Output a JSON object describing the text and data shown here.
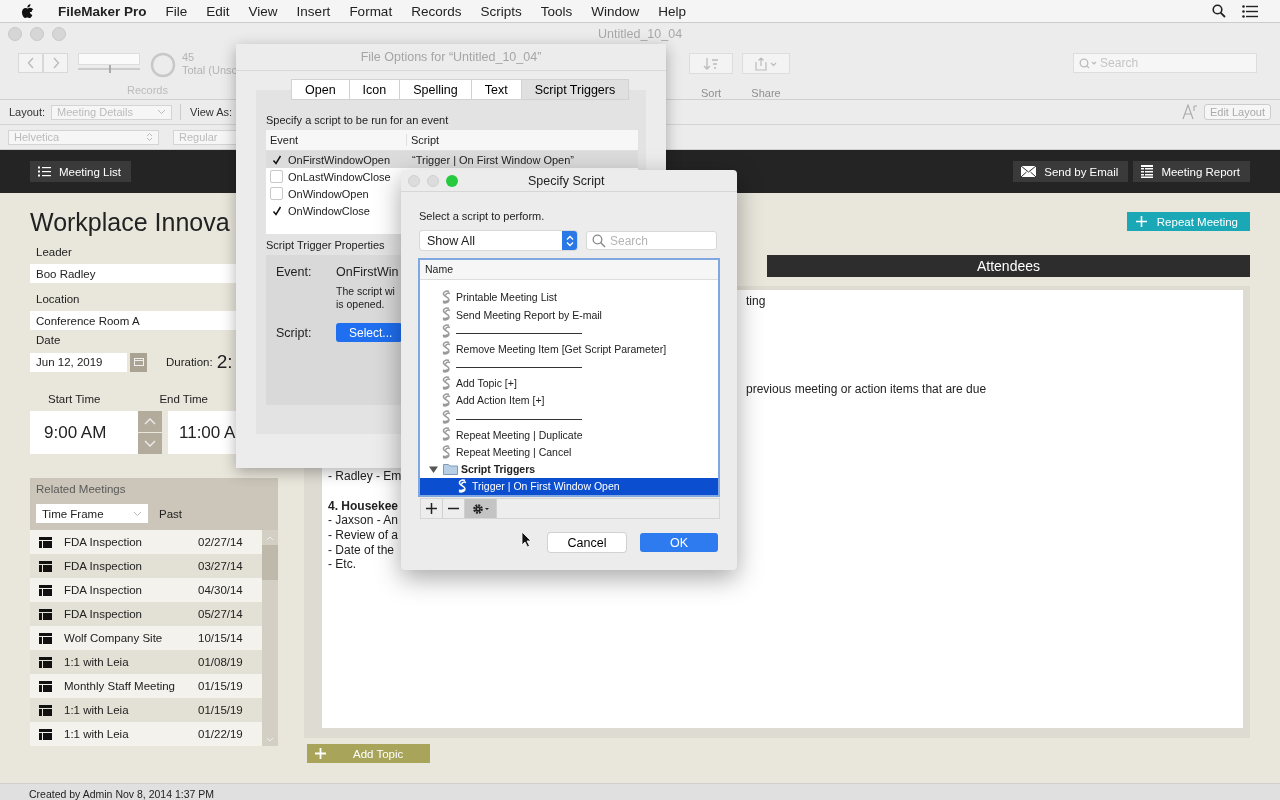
{
  "menu_bar": {
    "app": "FileMaker Pro",
    "items": [
      "File",
      "Edit",
      "View",
      "Insert",
      "Format",
      "Records",
      "Scripts",
      "Tools",
      "Window",
      "Help"
    ]
  },
  "window": {
    "title": "Untitled_10_04"
  },
  "toolbar": {
    "record_slider": {
      "level": 0.5
    },
    "record_count": "45",
    "total_label": "Total (Unsc",
    "records_label": "Records",
    "sort_label": "Sort",
    "share_label": "Share",
    "search": {
      "placeholder": "Search"
    }
  },
  "layout_bar": {
    "layout_label": "Layout:",
    "layout": "Meeting Details",
    "view_as_label": "View As:",
    "edit_layout": "Edit Layout"
  },
  "format_bar": {
    "font": "Helvetica",
    "style": "Regular"
  },
  "header_bar": {
    "meeting_list": "Meeting List",
    "send_by_email": "Send by Email",
    "meeting_report": "Meeting Report"
  },
  "record": {
    "title": "Workplace Innova",
    "fields": [
      {
        "label": "Leader",
        "value": "Boo Radley"
      },
      {
        "label": "Location",
        "value": "Conference Room A"
      }
    ],
    "date_label": "Date",
    "date": "Jun 12, 2019",
    "duration_label": "Duration:",
    "duration": "2:",
    "start_time_label": "Start Time",
    "start_time": "9:00 AM",
    "end_time_label": "End Time",
    "end_time": "11:00 A"
  },
  "related_meetings": {
    "title": "Related Meetings",
    "time_frame": "Time Frame",
    "filter": "Past",
    "rows": [
      {
        "name": "FDA Inspection",
        "date": "02/27/14"
      },
      {
        "name": "FDA Inspection",
        "date": "03/27/14"
      },
      {
        "name": "FDA Inspection",
        "date": "04/30/14"
      },
      {
        "name": "FDA Inspection",
        "date": "05/27/14"
      },
      {
        "name": "Wolf Company Site",
        "date": "10/15/14"
      },
      {
        "name": "1:1 with Leia",
        "date": "01/08/19"
      },
      {
        "name": "Monthly Staff Meeting",
        "date": "01/15/19"
      },
      {
        "name": "1:1 with Leia",
        "date": "01/15/19"
      },
      {
        "name": "1:1 with Leia",
        "date": "01/22/19"
      }
    ]
  },
  "repeat_meeting": "Repeat Meeting",
  "attendees_title": "Attendees",
  "notes": [
    {
      "kind": "tail",
      "text": "ting"
    },
    {
      "kind": "tail",
      "text": "previous meeting or action items that are due"
    },
    {
      "kind": "line",
      "text": "- Radley - Em"
    },
    {
      "kind": "heading",
      "text": "4. Housekee"
    },
    {
      "kind": "line",
      "text": "- Jaxson - An"
    },
    {
      "kind": "line",
      "text": "- Review of a"
    },
    {
      "kind": "line",
      "text": "- Date of the"
    },
    {
      "kind": "line",
      "text": "- Etc."
    }
  ],
  "add_topic": "Add Topic",
  "footer": "Created by Admin Nov 8, 2014 1:37 PM",
  "file_options": {
    "title": "File Options for “Untitled_10_04”",
    "tabs": [
      {
        "label": "Open",
        "selected": false
      },
      {
        "label": "Icon",
        "selected": false
      },
      {
        "label": "Spelling",
        "selected": false
      },
      {
        "label": "Text",
        "selected": false
      },
      {
        "label": "Script Triggers",
        "selected": true
      }
    ],
    "instruction": "Specify a script to be run for an event",
    "columns": [
      "Event",
      "Script"
    ],
    "events": [
      {
        "name": "OnFirstWindowOpen",
        "script": "“Trigger | On First Window Open”",
        "checked": true,
        "selected": true
      },
      {
        "name": "OnLastWindowClose",
        "checked": false,
        "selected": false
      },
      {
        "name": "OnWindowOpen",
        "checked": false,
        "selected": false
      },
      {
        "name": "OnWindowClose",
        "checked": true,
        "selected": false
      }
    ],
    "properties_title": "Script Trigger Properties",
    "event_label": "Event:",
    "event_value": "OnFirstWin",
    "description_lines": [
      "The script wi",
      "is opened."
    ],
    "script_label": "Script:",
    "select_button": "Select..."
  },
  "specify_script": {
    "title": "Specify Script",
    "instruction": "Select a script to perform.",
    "show": "Show All",
    "search": {
      "placeholder": "Search"
    },
    "column": "Name",
    "items": [
      {
        "kind": "script",
        "name": "Printable Meeting List",
        "selected": false
      },
      {
        "kind": "script",
        "name": "Send Meeting Report by E-mail",
        "selected": false
      },
      {
        "kind": "separator",
        "selected": false
      },
      {
        "kind": "script",
        "name": "Remove Meeting Item [Get Script Parameter]",
        "selected": false
      },
      {
        "kind": "separator",
        "selected": false
      },
      {
        "kind": "script",
        "name": "Add Topic [+]",
        "selected": false
      },
      {
        "kind": "script",
        "name": "Add Action Item [+]",
        "selected": false
      },
      {
        "kind": "separator",
        "selected": false
      },
      {
        "kind": "script",
        "name": "Repeat Meeting | Duplicate",
        "selected": false
      },
      {
        "kind": "script",
        "name": "Repeat Meeting | Cancel",
        "selected": false
      },
      {
        "kind": "folder",
        "name": "Script Triggers",
        "expanded": true,
        "selected": false,
        "children": [
          {
            "kind": "script",
            "name": "Trigger | On First Window Open",
            "selected": true
          }
        ]
      }
    ],
    "cancel": "Cancel",
    "ok": "OK"
  }
}
